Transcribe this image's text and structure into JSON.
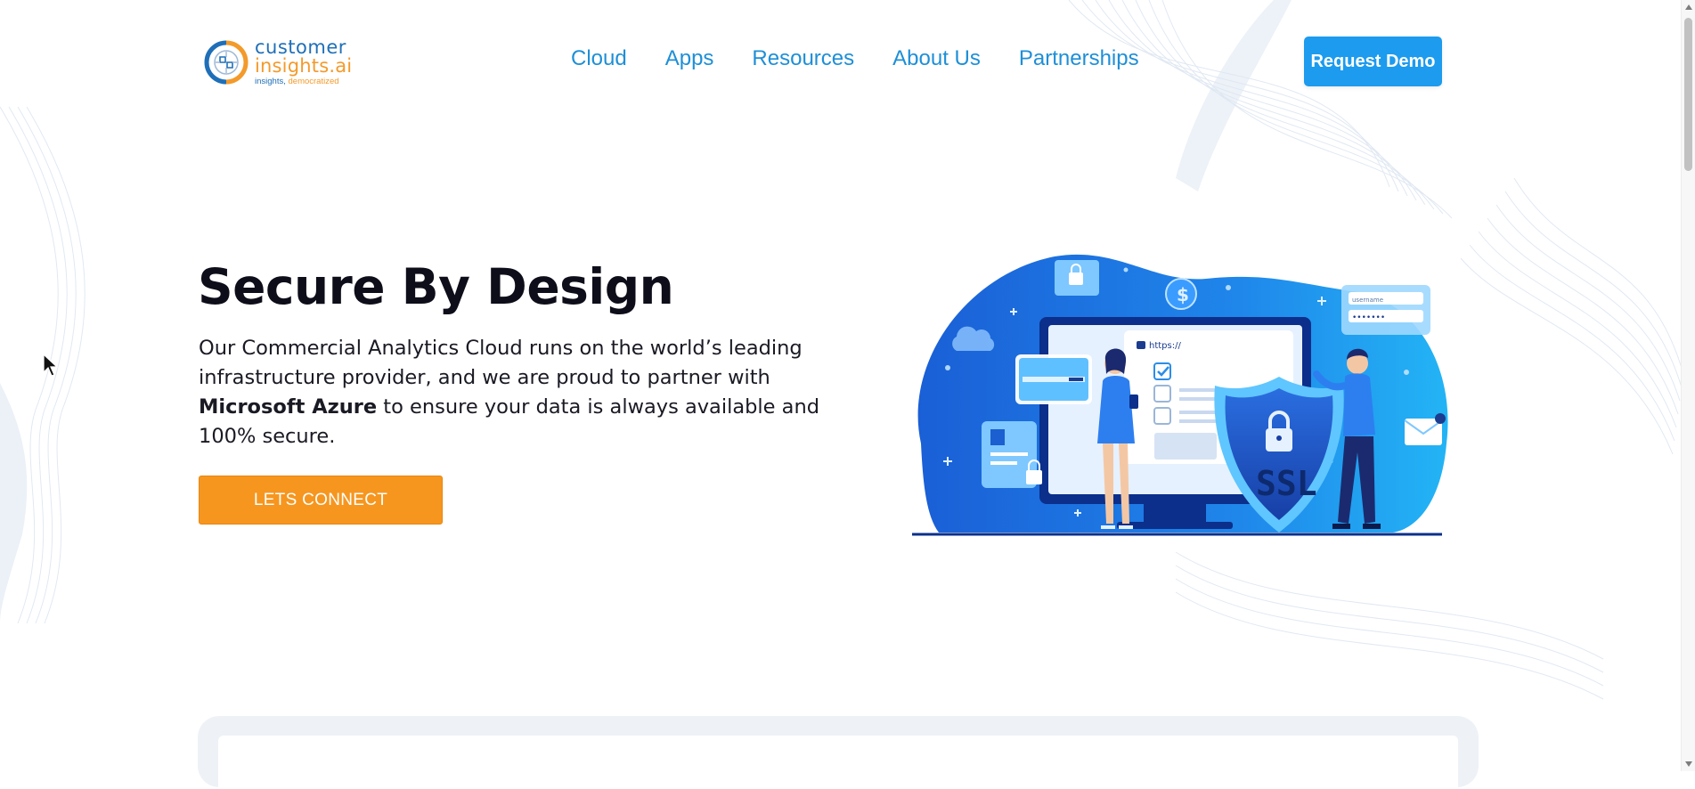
{
  "header": {
    "logo": {
      "line1": "customer",
      "line2": "insights.ai",
      "tagline_part1": "insights, ",
      "tagline_part2": "democratized"
    },
    "nav": [
      {
        "label": "Cloud"
      },
      {
        "label": "Apps"
      },
      {
        "label": "Resources"
      },
      {
        "label": "About Us"
      },
      {
        "label": "Partnerships"
      }
    ],
    "cta_label": "Request Demo"
  },
  "hero": {
    "title": "Secure By Design",
    "desc_part1": "Our Commercial Analytics Cloud runs on the world’s leading infrastructure provider, and we are proud to partner with ",
    "desc_strong": "Microsoft Azure",
    "desc_part2": " to ensure your data is always available and 100% secure.",
    "button_label": "LETS CONNECT"
  },
  "illustration": {
    "url_text": "https://",
    "badge_text": "SSL",
    "login_username_placeholder": "username",
    "login_password_mask": "•••••••"
  },
  "colors": {
    "nav": "#1e8fd7",
    "cta_blue": "#1c9bef",
    "cta_orange": "#f6961f",
    "title": "#0e0e1a"
  }
}
